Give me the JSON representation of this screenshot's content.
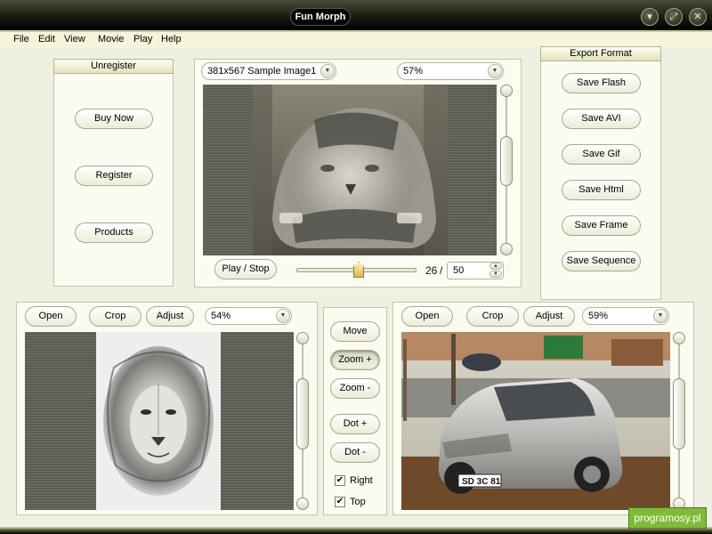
{
  "window": {
    "title": "Fun Morph",
    "minimize_glyph": "▾",
    "maximize_glyph": "⤢",
    "close_glyph": "✕"
  },
  "menu": [
    {
      "label": "File"
    },
    {
      "label": "Edit"
    },
    {
      "label": "View"
    },
    {
      "label": "Movie"
    },
    {
      "label": "Play"
    },
    {
      "label": "Help"
    }
  ],
  "unregister": {
    "title": "Unregister",
    "buttons": [
      {
        "label": "Buy Now"
      },
      {
        "label": "Register"
      },
      {
        "label": "Products"
      }
    ]
  },
  "preview": {
    "image_select": "381x567 Sample Image1",
    "zoom_select": "57%",
    "play_button": "Play / Stop",
    "frame_current": "26",
    "frame_separator": "/",
    "frame_total": "50",
    "frame_progress": 0.52
  },
  "export": {
    "title": "Export Format",
    "buttons": [
      {
        "label": "Save Flash"
      },
      {
        "label": "Save AVI"
      },
      {
        "label": "Save Gif"
      },
      {
        "label": "Save Html"
      },
      {
        "label": "Save Frame"
      },
      {
        "label": "Save Sequence"
      }
    ]
  },
  "left_editor": {
    "open": "Open",
    "crop": "Crop",
    "adjust": "Adjust",
    "zoom": "54%"
  },
  "right_editor": {
    "open": "Open",
    "crop": "Crop",
    "adjust": "Adjust",
    "zoom": "59%"
  },
  "tools": {
    "move": "Move",
    "zoom_in": "Zoom +",
    "zoom_out": "Zoom -",
    "dot_add": "Dot +",
    "dot_remove": "Dot -",
    "right_label": "Right",
    "right_checked": true,
    "top_label": "Top",
    "top_checked": true
  },
  "car_plate": "SD 3C 81",
  "watermark": "programosy.pl",
  "colors": {
    "accent": "#e2e2bc",
    "titlebar": "#1b1b12",
    "watermark": "#7fba3a"
  }
}
